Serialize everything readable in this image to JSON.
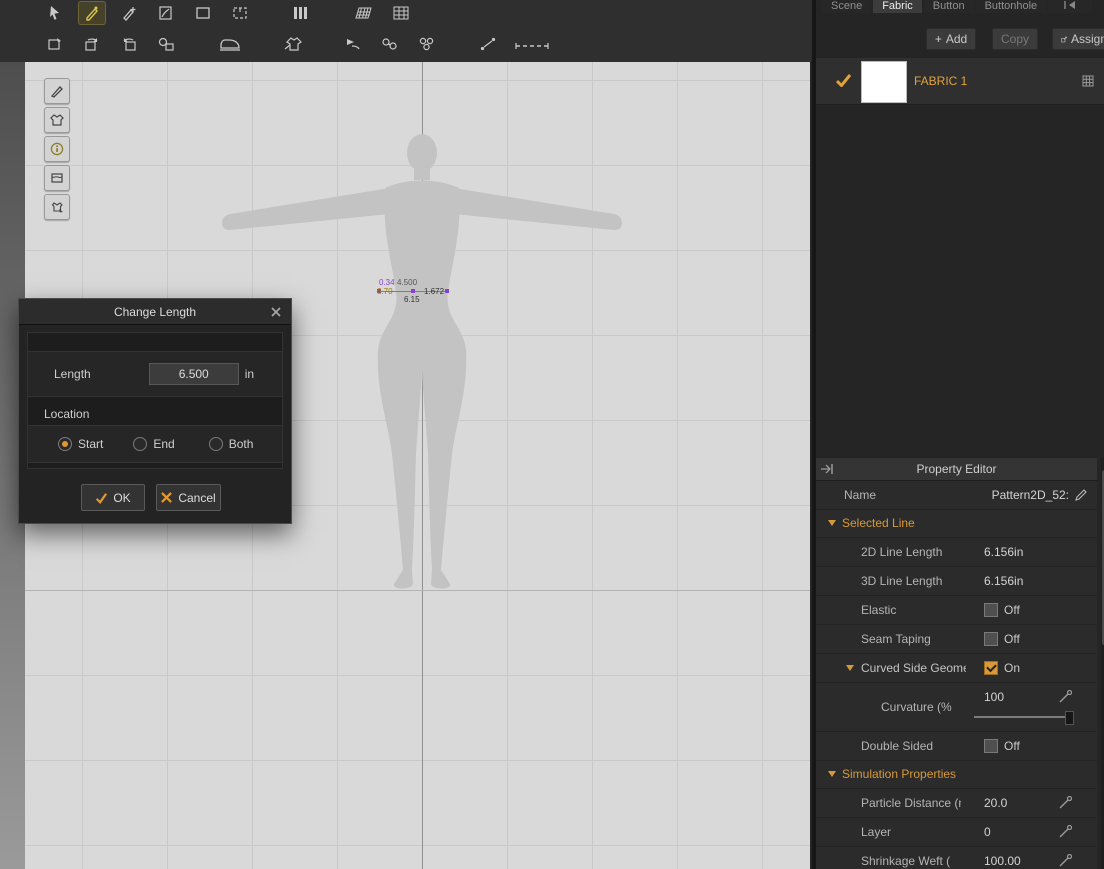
{
  "canvas": {
    "measurements": {
      "m1": "0.34",
      "m2": "4.500",
      "m3": "6.70",
      "m4": "1.672",
      "m5": "6.15"
    }
  },
  "dialog": {
    "title": "Change Length",
    "length_label": "Length",
    "length_value": "6.500",
    "length_unit": "in",
    "location_label": "Location",
    "radios": [
      {
        "label": "Start",
        "selected": true
      },
      {
        "label": "End",
        "selected": false
      },
      {
        "label": "Both",
        "selected": false
      }
    ],
    "ok_label": "OK",
    "cancel_label": "Cancel"
  },
  "right_panel": {
    "tabs": [
      {
        "label": "Scene"
      },
      {
        "label": "Fabric"
      },
      {
        "label": "Button"
      },
      {
        "label": "Buttonhole"
      }
    ],
    "add_label": "Add",
    "copy_label": "Copy",
    "assign_label": "Assign",
    "fabric_name": "FABRIC 1"
  },
  "property_editor": {
    "title": "Property Editor",
    "name_label": "Name",
    "name_value": "Pattern2D_52:",
    "selected_line_header": "Selected Line",
    "rows": {
      "line2d": {
        "label": "2D Line Length",
        "value": "6.156in"
      },
      "line3d": {
        "label": "3D Line Length",
        "value": "6.156in"
      },
      "elastic": {
        "label": "Elastic",
        "value": "Off"
      },
      "seam_taping": {
        "label": "Seam Taping",
        "value": "Off"
      },
      "curved_side": {
        "label": "Curved Side Geometry",
        "value": "On"
      },
      "curvature": {
        "label": "Curvature (%",
        "value": "100"
      },
      "double_side": {
        "label": "Double Sided",
        "value": "Off"
      }
    },
    "simulation_header": "Simulation Properties",
    "sim_rows": {
      "particle": {
        "label": "Particle Distance (mm",
        "value": "20.0"
      },
      "layer": {
        "label": "Layer",
        "value": "0"
      },
      "shrinkage": {
        "label": "Shrinkage Weft (",
        "value": "100.00"
      }
    }
  }
}
